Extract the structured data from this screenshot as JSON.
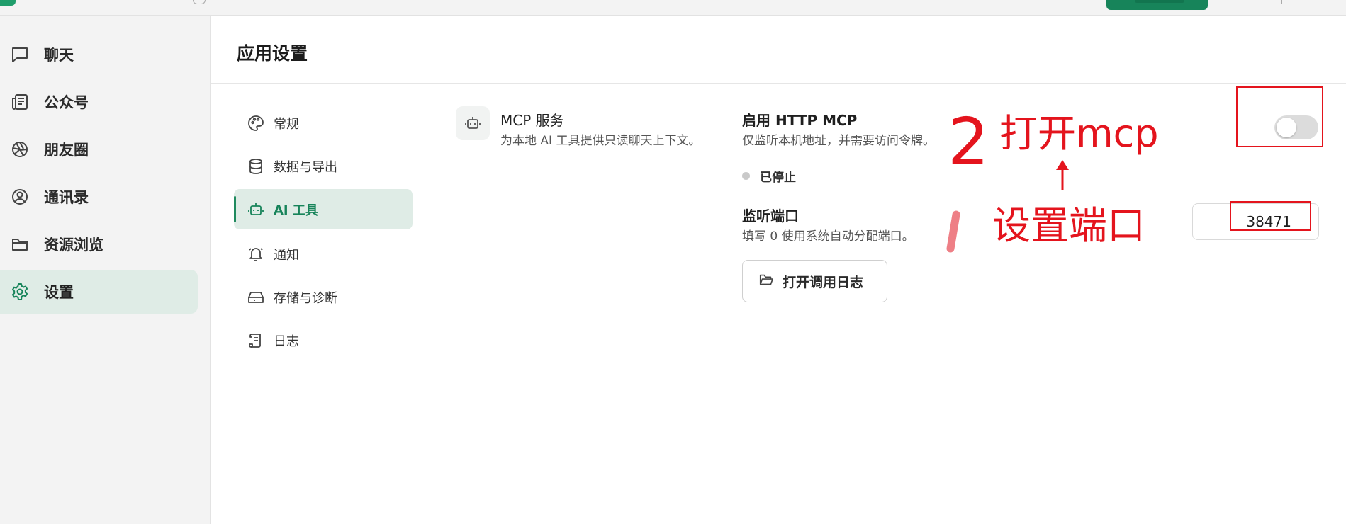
{
  "left_nav": {
    "items": [
      {
        "label": "聊天",
        "icon": "chat-bubble-icon",
        "active": false
      },
      {
        "label": "公众号",
        "icon": "newspaper-icon",
        "active": false
      },
      {
        "label": "朋友圈",
        "icon": "aperture-icon",
        "active": false
      },
      {
        "label": "通讯录",
        "icon": "contact-circle-icon",
        "active": false
      },
      {
        "label": "资源浏览",
        "icon": "folder-icon",
        "active": false
      },
      {
        "label": "设置",
        "icon": "gear-icon",
        "active": true
      }
    ]
  },
  "page": {
    "title": "应用设置"
  },
  "settings_nav": {
    "items": [
      {
        "label": "常规",
        "icon": "palette-icon",
        "active": false
      },
      {
        "label": "数据与导出",
        "icon": "database-icon",
        "active": false
      },
      {
        "label": "AI 工具",
        "icon": "robot-icon",
        "active": true
      },
      {
        "label": "通知",
        "icon": "bell-icon",
        "active": false
      },
      {
        "label": "存储与诊断",
        "icon": "hard-drive-icon",
        "active": false
      },
      {
        "label": "日志",
        "icon": "scroll-icon",
        "active": false
      }
    ]
  },
  "mcp": {
    "icon": "robot-icon",
    "title": "MCP 服务",
    "description": "为本地 AI 工具提供只读聊天上下文。",
    "http": {
      "title": "启用 HTTP MCP",
      "description": "仅监听本机地址，并需要访问令牌。",
      "enabled": false
    },
    "status": "已停止",
    "port": {
      "title": "监听端口",
      "description": "填写 0 使用系统自动分配端口。",
      "value": "38471"
    },
    "log_button": {
      "label": "打开调用日志",
      "icon": "folder-open-icon"
    }
  },
  "annotations": {
    "step2_number": "2",
    "step2_text": "打开mcp",
    "step1_text": "设置端口",
    "color": "#e4141d"
  },
  "colors": {
    "accent": "#17845a",
    "active_bg": "#dfece6",
    "sidebar_bg": "#f3f3f3"
  }
}
